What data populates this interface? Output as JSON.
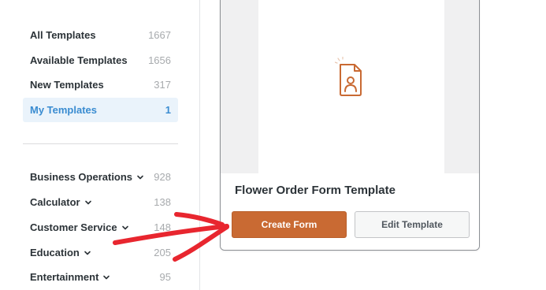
{
  "sidebar": {
    "main_items": [
      {
        "label": "All Templates",
        "count": "1667"
      },
      {
        "label": "Available Templates",
        "count": "1656"
      },
      {
        "label": "New Templates",
        "count": "317"
      },
      {
        "label": "My Templates",
        "count": "1"
      }
    ],
    "active_item": "My Templates",
    "categories": [
      {
        "label": "Business Operations",
        "count": "928"
      },
      {
        "label": "Calculator",
        "count": "138"
      },
      {
        "label": "Customer Service",
        "count": "148"
      },
      {
        "label": "Education",
        "count": "205"
      },
      {
        "label": "Entertainment",
        "count": "95"
      }
    ]
  },
  "template_card": {
    "title": "Flower Order Form Template",
    "preview_icon": "document-user-icon",
    "create_label": "Create Form",
    "edit_label": "Edit Template"
  },
  "annotation": {
    "type": "hand-drawn-arrow",
    "points_to": "Create Form"
  },
  "colors": {
    "accent_orange": "#c96a33",
    "active_blue": "#3a8cd1",
    "annotation_red": "#e8262f"
  }
}
